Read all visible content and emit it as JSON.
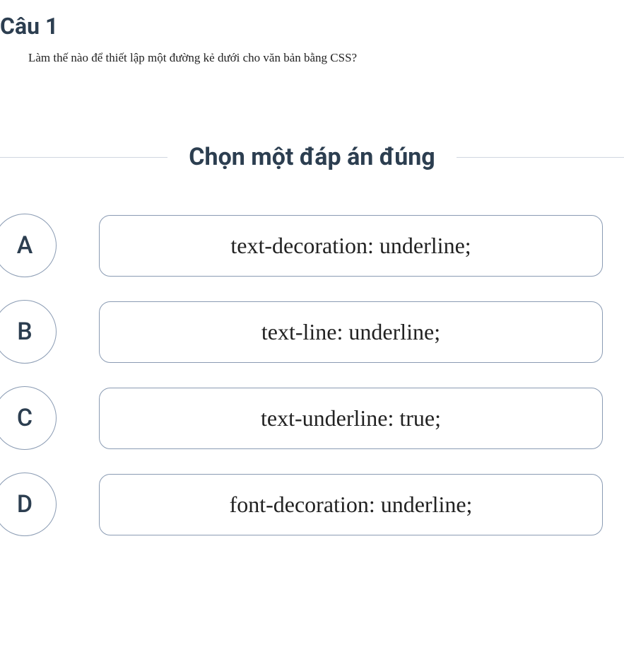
{
  "question": {
    "title": "Câu 1",
    "text": "Làm thế nào để thiết lập một đường kẻ dưới cho văn bản bằng CSS?"
  },
  "instruction": "Chọn một đáp án đúng",
  "options": [
    {
      "letter": "A",
      "text": "text-decoration: underline;"
    },
    {
      "letter": "B",
      "text": "text-line: underline;"
    },
    {
      "letter": "C",
      "text": "text-underline: true;"
    },
    {
      "letter": "D",
      "text": "font-decoration: underline;"
    }
  ]
}
